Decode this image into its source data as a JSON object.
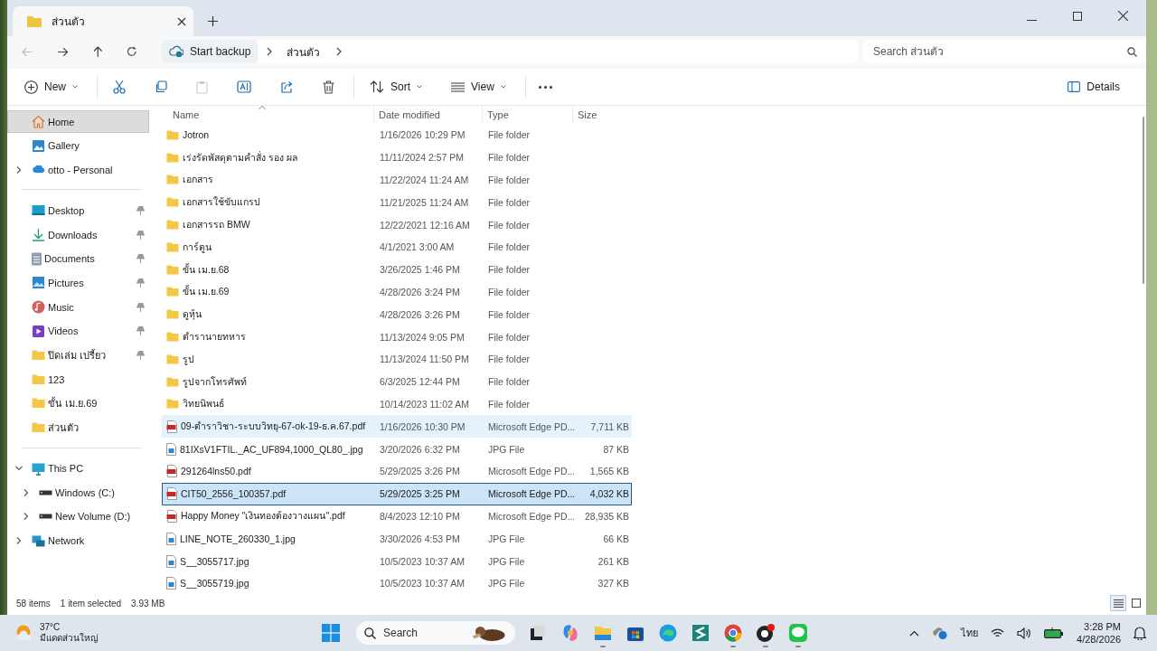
{
  "tabs": [
    {
      "label": "ส่วนตัว",
      "selected": true
    }
  ],
  "breadcrumbs": [
    "Start backup",
    "ส่วนตัว"
  ],
  "search": {
    "placeholder": "Search ส่วนตัว"
  },
  "toolbar": [
    {
      "kind": "new",
      "label": "New",
      "disabled": false
    },
    {
      "kind": "cut",
      "disabled": false
    },
    {
      "kind": "copy",
      "disabled": false
    },
    {
      "kind": "paste",
      "disabled": true
    },
    {
      "kind": "rename",
      "disabled": false
    },
    {
      "kind": "share",
      "disabled": false
    },
    {
      "kind": "delete",
      "disabled": false
    },
    {
      "kind": "sort",
      "label": "Sort",
      "disabled": false
    },
    {
      "kind": "view",
      "label": "View",
      "disabled": false
    },
    {
      "kind": "more",
      "disabled": false
    }
  ],
  "details_button": {
    "label": "Details"
  },
  "sidebar": [
    [
      {
        "label": "Home",
        "kind": "home",
        "selected": true,
        "pinned": false,
        "expanded": false,
        "expandable": false
      },
      {
        "label": "Gallery",
        "kind": "gallery",
        "selected": false,
        "pinned": false,
        "expanded": false,
        "expandable": false
      },
      {
        "label": "otto - Personal",
        "kind": "cloud",
        "selected": false,
        "pinned": false,
        "expanded": false,
        "expandable": true
      }
    ],
    [
      {
        "label": "Desktop",
        "kind": "desktop",
        "selected": false,
        "pinned": true,
        "expanded": false,
        "expandable": false
      },
      {
        "label": "Downloads",
        "kind": "downloads",
        "selected": false,
        "pinned": true,
        "expanded": false,
        "expandable": false
      },
      {
        "label": "Documents",
        "kind": "documents",
        "selected": false,
        "pinned": true,
        "expanded": false,
        "expandable": false
      },
      {
        "label": "Pictures",
        "kind": "pictures",
        "selected": false,
        "pinned": true,
        "expanded": false,
        "expandable": false
      },
      {
        "label": "Music",
        "kind": "music",
        "selected": false,
        "pinned": true,
        "expanded": false,
        "expandable": false
      },
      {
        "label": "Videos",
        "kind": "videos",
        "selected": false,
        "pinned": true,
        "expanded": false,
        "expandable": false
      },
      {
        "label": "ปิดเล่ม เปรี้ยว",
        "kind": "folder",
        "selected": false,
        "pinned": true,
        "expanded": false,
        "expandable": false
      },
      {
        "label": "123",
        "kind": "folder",
        "selected": false,
        "pinned": false,
        "expanded": false,
        "expandable": false
      },
      {
        "label": "ขั้น เม.ย.69",
        "kind": "folder",
        "selected": false,
        "pinned": false,
        "expanded": false,
        "expandable": false
      },
      {
        "label": "ส่วนตัว",
        "kind": "folder",
        "selected": false,
        "pinned": false,
        "expanded": false,
        "expandable": false
      }
    ],
    [
      {
        "label": "This PC",
        "kind": "pc",
        "selected": false,
        "pinned": false,
        "expanded": true,
        "expandable": true,
        "children": [
          {
            "label": "Windows (C:)",
            "kind": "drive",
            "selected": false,
            "pinned": false,
            "expanded": false,
            "expandable": true
          },
          {
            "label": "New Volume (D:)",
            "kind": "drive",
            "selected": false,
            "pinned": false,
            "expanded": false,
            "expandable": true
          }
        ]
      },
      {
        "label": "Network",
        "kind": "network",
        "selected": false,
        "pinned": false,
        "expanded": false,
        "expandable": true
      }
    ]
  ],
  "columns": [
    "Name",
    "Date modified",
    "Type",
    "Size"
  ],
  "rows": [
    {
      "kind": "folder",
      "name": "Jotron",
      "date": "1/16/2026 10:29 PM",
      "type": "File folder",
      "selected": false,
      "hovered": false
    },
    {
      "kind": "folder",
      "name": "เร่งรัดพัสดุตามคำสั่ง รอง ผล",
      "date": "11/11/2024 2:57 PM",
      "type": "File folder",
      "selected": false,
      "hovered": false
    },
    {
      "kind": "folder",
      "name": "เอกสาร",
      "date": "11/22/2024 11:24 AM",
      "type": "File folder",
      "selected": false,
      "hovered": false
    },
    {
      "kind": "folder",
      "name": "เอกสารใช้ขับแกรป",
      "date": "11/21/2025 11:24 AM",
      "type": "File folder",
      "selected": false,
      "hovered": false
    },
    {
      "kind": "folder",
      "name": "เอกสารรถ BMW",
      "date": "12/22/2021 12:16 AM",
      "type": "File folder",
      "selected": false,
      "hovered": false
    },
    {
      "kind": "folder",
      "name": "การ์ตูน",
      "date": "4/1/2021 3:00 AM",
      "type": "File folder",
      "selected": false,
      "hovered": false
    },
    {
      "kind": "folder",
      "name": "ขั้น เม.ย.68",
      "date": "3/26/2025 1:46 PM",
      "type": "File folder",
      "selected": false,
      "hovered": false
    },
    {
      "kind": "folder",
      "name": "ขั้น เม.ย.69",
      "date": "4/28/2026 3:24 PM",
      "type": "File folder",
      "selected": false,
      "hovered": false
    },
    {
      "kind": "folder",
      "name": "ดูหุ้น",
      "date": "4/28/2026 3:26 PM",
      "type": "File folder",
      "selected": false,
      "hovered": false
    },
    {
      "kind": "folder",
      "name": "ตำรานายทหาร",
      "date": "11/13/2024 9:05 PM",
      "type": "File folder",
      "selected": false,
      "hovered": false
    },
    {
      "kind": "folder",
      "name": "รูป",
      "date": "11/13/2024 11:50 PM",
      "type": "File folder",
      "selected": false,
      "hovered": false
    },
    {
      "kind": "folder",
      "name": "รูปจากโทรศัพท์",
      "date": "6/3/2025 12:44 PM",
      "type": "File folder",
      "selected": false,
      "hovered": false
    },
    {
      "kind": "folder",
      "name": "วิทยนิพนธ์",
      "date": "10/14/2023 11:02 AM",
      "type": "File folder",
      "selected": false,
      "hovered": false
    },
    {
      "kind": "pdf",
      "name": "09-ตำราวิชา-ระบบวิทยุ-67-ok-19-ธ.ค.67.pdf",
      "date": "1/16/2026 10:30 PM",
      "type": "Microsoft Edge PD...",
      "size": "7,711 KB",
      "selected": false,
      "hovered": true
    },
    {
      "kind": "image",
      "name": "81IXsV1FTIL._AC_UF894,1000_QL80_.jpg",
      "date": "3/20/2026 6:32 PM",
      "type": "JPG File",
      "size": "87 KB",
      "selected": false,
      "hovered": false
    },
    {
      "kind": "pdf",
      "name": "291264lns50.pdf",
      "date": "5/29/2025 3:26 PM",
      "type": "Microsoft Edge PD...",
      "size": "1,565 KB",
      "selected": false,
      "hovered": false
    },
    {
      "kind": "pdf",
      "name": "CIT50_2556_100357.pdf",
      "date": "5/29/2025 3:25 PM",
      "type": "Microsoft Edge PD...",
      "size": "4,032 KB",
      "selected": true,
      "hovered": false
    },
    {
      "kind": "pdf",
      "name": "Happy Money \"เงินทองต้องวางแผน\".pdf",
      "date": "8/4/2023 12:10 PM",
      "type": "Microsoft Edge PD...",
      "size": "28,935 KB",
      "selected": false,
      "hovered": false
    },
    {
      "kind": "image",
      "name": "LINE_NOTE_260330_1.jpg",
      "date": "3/30/2026 4:53 PM",
      "type": "JPG File",
      "size": "66 KB",
      "selected": false,
      "hovered": false
    },
    {
      "kind": "image",
      "name": "S__3055717.jpg",
      "date": "10/5/2023 10:37 AM",
      "type": "JPG File",
      "size": "261 KB",
      "selected": false,
      "hovered": false
    },
    {
      "kind": "image",
      "name": "S__3055719.jpg",
      "date": "10/5/2023 10:37 AM",
      "type": "JPG File",
      "size": "327 KB",
      "selected": false,
      "hovered": false
    }
  ],
  "status": {
    "count": "58 items",
    "selection": "1 item selected",
    "size": "3.93 MB"
  },
  "views": [
    {
      "kind": "details",
      "selected": true
    },
    {
      "kind": "tiles",
      "selected": false
    }
  ],
  "taskbar": {
    "weather": {
      "temp": "37°C",
      "condition": "มีแดดส่วนใหญ่"
    },
    "search": {
      "placeholder": "Search"
    },
    "apps": [
      {
        "kind": "taskview",
        "running": false
      },
      {
        "kind": "copilot",
        "running": false
      },
      {
        "kind": "explorer",
        "running": true
      },
      {
        "kind": "store",
        "running": false
      },
      {
        "kind": "edge",
        "running": false
      },
      {
        "kind": "sapp",
        "running": false
      },
      {
        "kind": "chrome",
        "running": true
      },
      {
        "kind": "obs",
        "running": true
      },
      {
        "kind": "line",
        "running": true
      }
    ],
    "language": "ไทย",
    "time": "3:28 PM",
    "date": "4/28/2026"
  }
}
